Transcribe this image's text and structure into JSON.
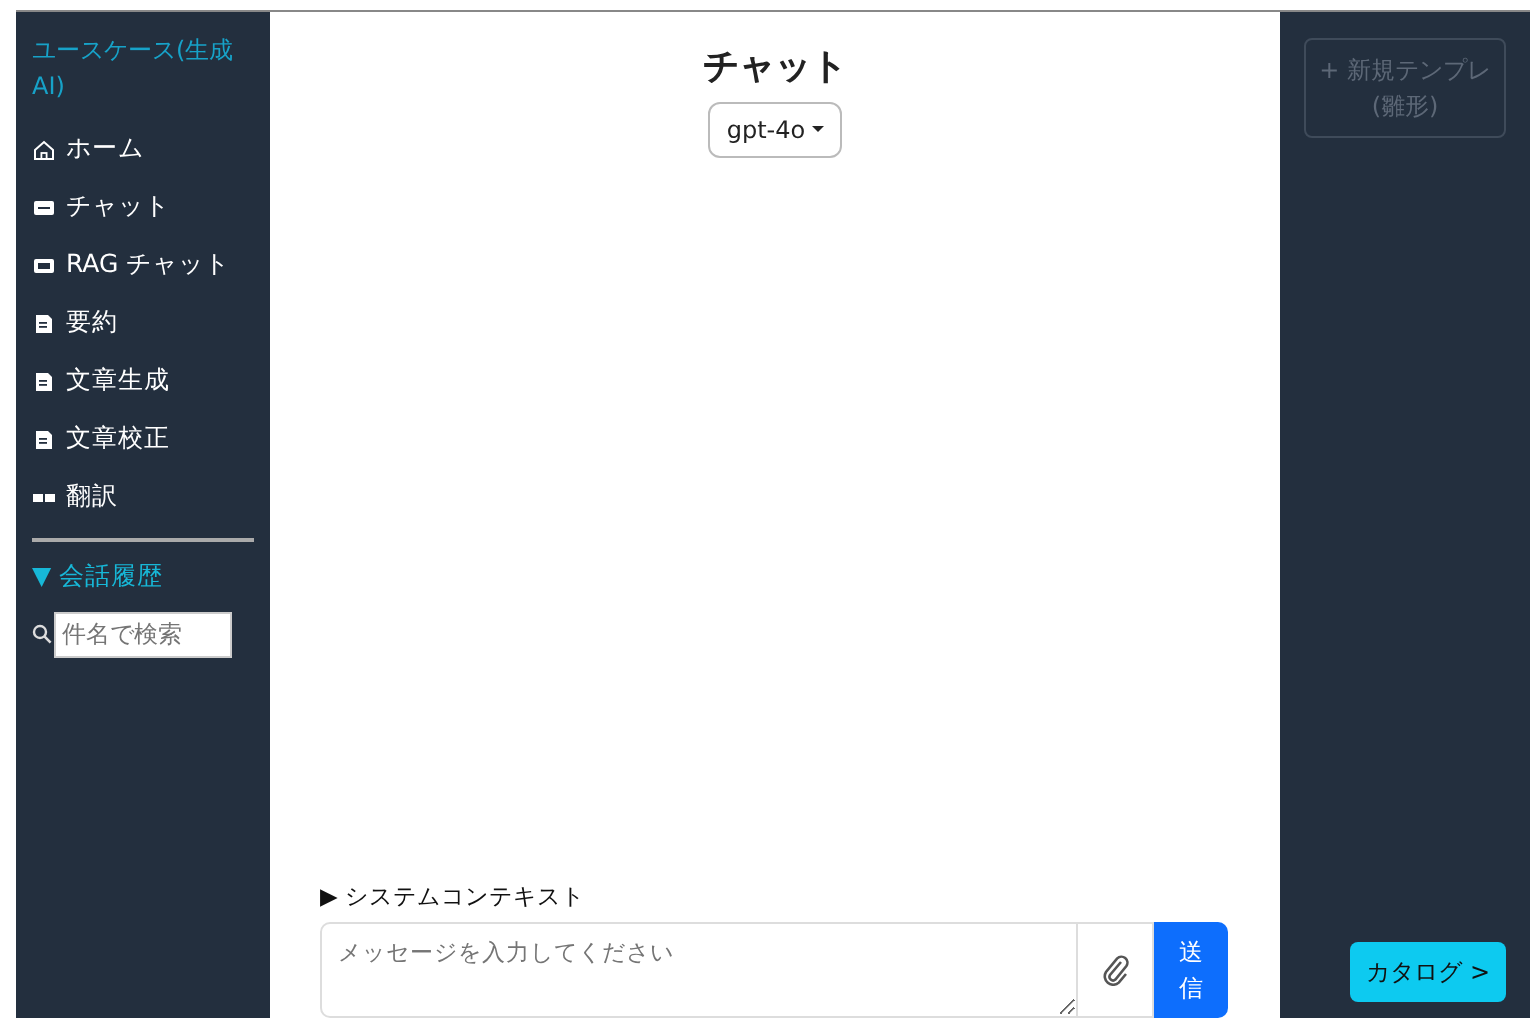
{
  "sidebar": {
    "title": "ユースケース(生成AI)",
    "items": [
      {
        "label": "ホーム",
        "kind": "home"
      },
      {
        "label": "チャット",
        "kind": "chat"
      },
      {
        "label": "RAG チャット",
        "kind": "rag"
      },
      {
        "label": "要約",
        "kind": "doc"
      },
      {
        "label": "文章生成",
        "kind": "doc"
      },
      {
        "label": "文章校正",
        "kind": "doc"
      },
      {
        "label": "翻訳",
        "kind": "translate"
      }
    ],
    "history": {
      "label": "▼ 会話履歴",
      "search_placeholder": "件名で検索"
    }
  },
  "main": {
    "title": "チャット",
    "model": "gpt-4o",
    "system_context": "▶ システムコンテキスト",
    "message_placeholder": "メッセージを入力してください",
    "send": "送信"
  },
  "right": {
    "new_template": "+ 新規テンプレ (雛形)",
    "new_template_disabled": true,
    "catalog": "カタログ >"
  }
}
